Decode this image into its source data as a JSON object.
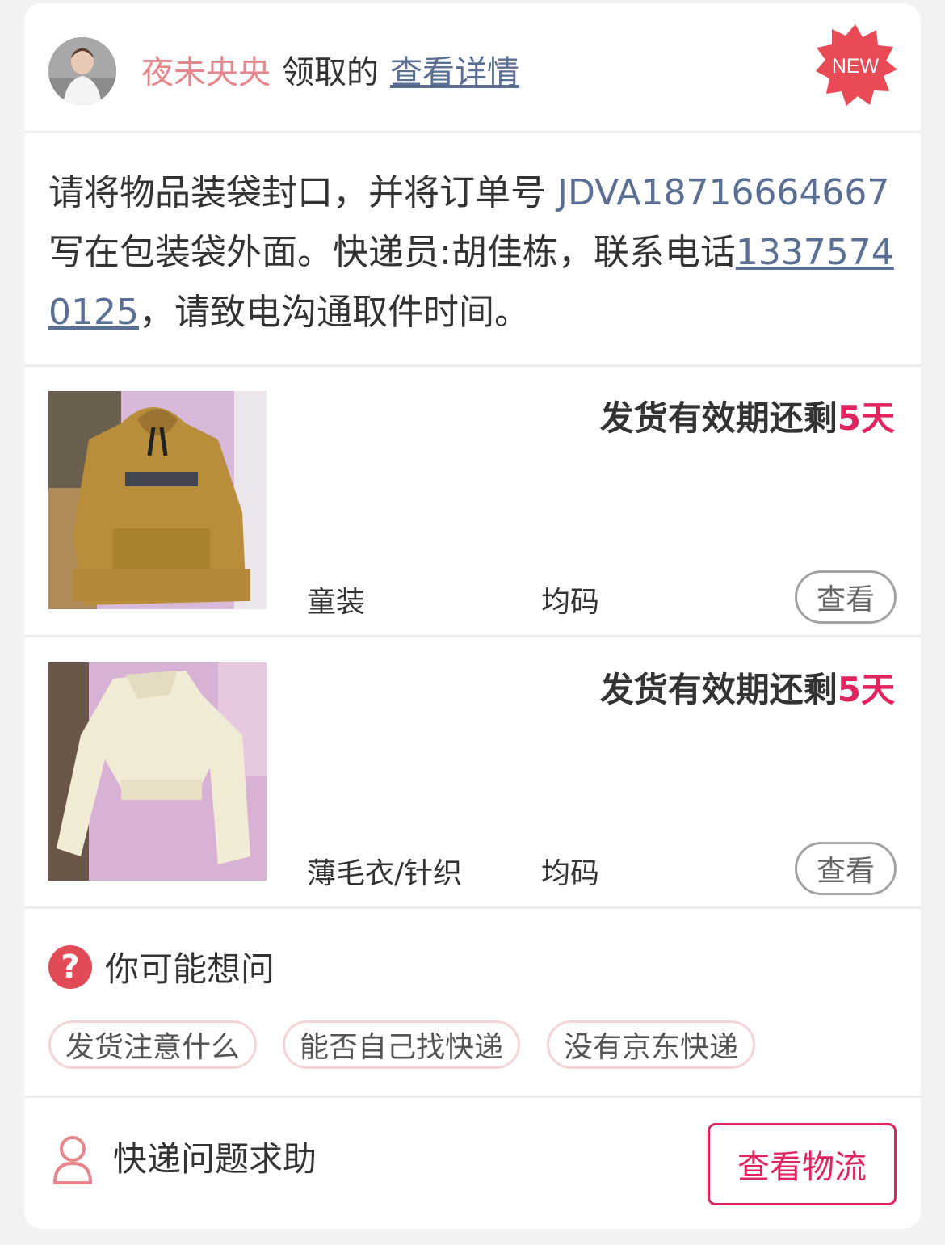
{
  "header": {
    "username": "夜未央央",
    "claimed_text": "领取的",
    "detail_link": "查看详情",
    "badge": "NEW"
  },
  "instruction": {
    "text_before": "请将物品装袋封口，并将订单号 ",
    "order_number": "JDVA18716664667",
    "text_middle": " 写在包装袋外面。快递员:胡佳栋，联系电话",
    "phone": "13375740125",
    "text_after": "，请致电沟通取件时间。"
  },
  "items": [
    {
      "deadline_prefix": "发货有效期还剩",
      "deadline_days": "5天",
      "category": "童装",
      "size": "均码",
      "view_label": "查看"
    },
    {
      "deadline_prefix": "发货有效期还剩",
      "deadline_days": "5天",
      "category": "薄毛衣/针织",
      "size": "均码",
      "view_label": "查看"
    }
  ],
  "faq": {
    "title": "你可能想问",
    "chips": [
      "发货注意什么",
      "能否自己找快递",
      "没有京东快递"
    ]
  },
  "footer": {
    "help_text": "快递问题求助",
    "logistics_button": "查看物流"
  },
  "colors": {
    "accent": "#e0245e",
    "link": "#5a6f93",
    "username": "#e8868d",
    "badge": "#e84b55"
  }
}
